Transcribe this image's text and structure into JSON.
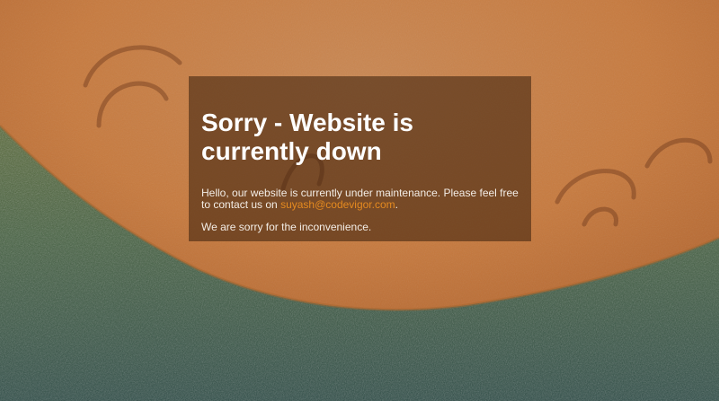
{
  "page": {
    "title": "Sorry - Website is currently down",
    "message": {
      "before_link": "Hello, our website is currently under maintenance. Please feel free to contact us on ",
      "email": "suyash@codevigor.com",
      "after_link": "."
    },
    "apology": "We are sorry for the inconvenience."
  },
  "colors": {
    "link": "#e58a1f",
    "card_overlay": "rgba(62,34,14,0.58)",
    "sand": "#c77a3e",
    "grass": "#3b5a42"
  }
}
